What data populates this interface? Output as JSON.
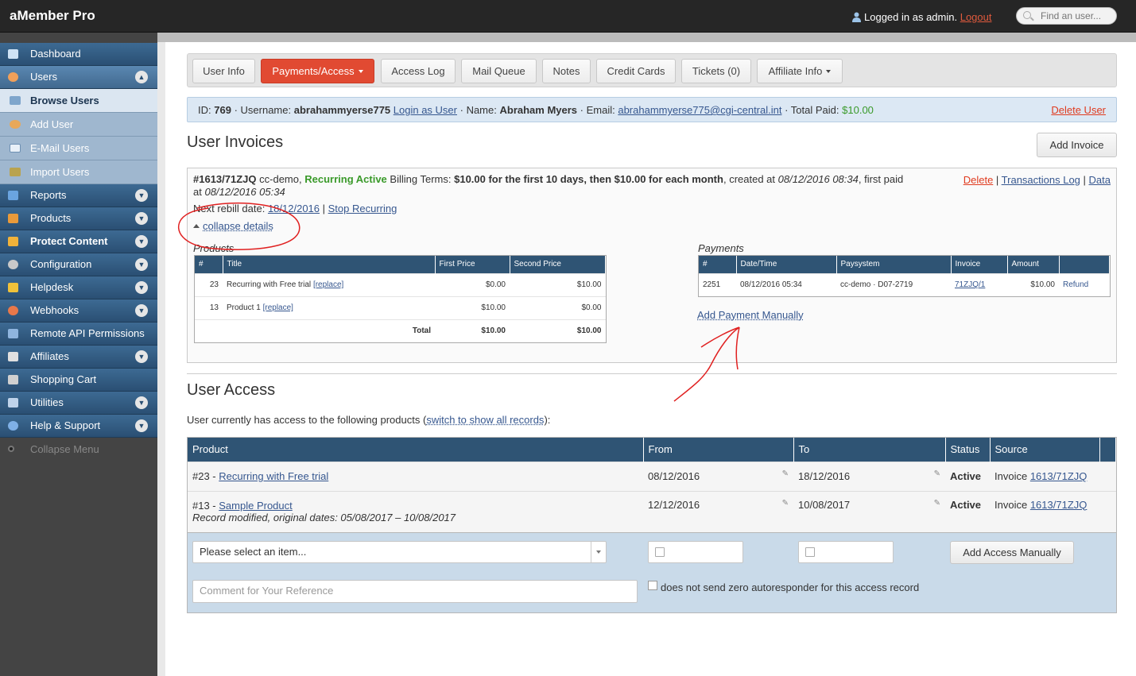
{
  "app": {
    "title": "aMember Pro"
  },
  "header": {
    "logged_in_text": "Logged in as admin.",
    "logout_label": "Logout",
    "search_placeholder": "Find an user..."
  },
  "sidebar": {
    "items": [
      {
        "label": "Dashboard",
        "icon": "dashboard-icon"
      },
      {
        "label": "Users",
        "icon": "users-icon"
      },
      {
        "label": "Browse Users",
        "icon": "browse-users-icon"
      },
      {
        "label": "Add User",
        "icon": "add-user-icon"
      },
      {
        "label": "E-Mail Users",
        "icon": "email-icon"
      },
      {
        "label": "Import Users",
        "icon": "import-icon"
      },
      {
        "label": "Reports",
        "icon": "reports-icon"
      },
      {
        "label": "Products",
        "icon": "products-icon"
      },
      {
        "label": "Protect Content",
        "icon": "lock-icon"
      },
      {
        "label": "Configuration",
        "icon": "gear-icon"
      },
      {
        "label": "Helpdesk",
        "icon": "helpdesk-icon"
      },
      {
        "label": "Webhooks",
        "icon": "webhooks-icon"
      },
      {
        "label": "Remote API Permissions",
        "icon": "api-icon"
      },
      {
        "label": "Affiliates",
        "icon": "affiliates-icon"
      },
      {
        "label": "Shopping Cart",
        "icon": "cart-icon"
      },
      {
        "label": "Utilities",
        "icon": "wrench-icon"
      },
      {
        "label": "Help & Support",
        "icon": "help-icon"
      }
    ],
    "collapse_label": "Collapse Menu"
  },
  "tabs": [
    "User Info",
    "Payments/Access",
    "Access Log",
    "Mail Queue",
    "Notes",
    "Credit Cards",
    "Tickets (0)",
    "Affiliate Info"
  ],
  "info": {
    "id_label": "ID:",
    "id": "769",
    "username_label": "· Username:",
    "username": "abrahammyerse775",
    "login_as": "Login as User",
    "name_label": "· Name:",
    "name": "Abraham Myers",
    "email_label": "· Email:",
    "email": "abrahammyerse775@cgi-central.int",
    "paid_label": "· Total Paid:",
    "paid": "$10.00",
    "delete": "Delete User"
  },
  "invoices": {
    "heading": "User Invoices",
    "add_button": "Add Invoice",
    "invoice_id": "#1613/71ZJQ",
    "paysys": "cc-demo,",
    "status": "Recurring Active",
    "terms_label": "Billing Terms:",
    "terms": "$10.00 for the first 10 days, then $10.00 for each month",
    "created_label": ", created at",
    "created": "08/12/2016 08:34",
    "first_paid_label": ", first paid at",
    "first_paid": "08/12/2016 05:34",
    "rebill_label": "Next rebill date:",
    "rebill_date": "18/12/2016",
    "stop_recurring": "Stop Recurring",
    "links": {
      "delete": "Delete",
      "transactions": "Transactions Log",
      "data": "Data"
    },
    "collapse": "collapse details",
    "products_caption": "Products",
    "products_headers": [
      "#",
      "Title",
      "First Price",
      "Second Price"
    ],
    "products": [
      {
        "num": "23",
        "title": "Recurring with Free trial",
        "replace": "[replace]",
        "first": "$0.00",
        "second": "$10.00"
      },
      {
        "num": "13",
        "title": "Product 1",
        "replace": "[replace]",
        "first": "$10.00",
        "second": "$0.00"
      }
    ],
    "total_label": "Total",
    "total_first": "$10.00",
    "total_second": "$10.00",
    "payments_caption": "Payments",
    "payments_headers": [
      "#",
      "Date/Time",
      "Paysystem",
      "Invoice",
      "Amount",
      ""
    ],
    "payments": [
      {
        "num": "2251",
        "datetime": "08/12/2016 05:34",
        "paysystem": "cc-demo · D07-2719",
        "invoice": "71ZJQ/1",
        "amount": "$10.00",
        "refund": "Refund"
      }
    ],
    "add_payment": "Add Payment Manually"
  },
  "access": {
    "heading": "User Access",
    "note_prefix": "User currently has access to the following products (",
    "note_link": "switch to show all records",
    "note_suffix": "):",
    "headers": [
      "Product",
      "From",
      "To",
      "Status",
      "Source"
    ],
    "rows": [
      {
        "num": "#23 -",
        "product": "Recurring with Free trial",
        "from": "08/12/2016",
        "to": "18/12/2016",
        "status": "Active",
        "source_prefix": "Invoice",
        "source": "1613/71ZJQ",
        "note": ""
      },
      {
        "num": "#13 -",
        "product": "Sample Product",
        "from": "12/12/2016",
        "to": "10/08/2017",
        "status": "Active",
        "source_prefix": "Invoice",
        "source": "1613/71ZJQ",
        "note": "Record modified, original dates: 05/08/2017 – 10/08/2017"
      }
    ],
    "select_placeholder": "Please select an item...",
    "add_button": "Add Access Manually",
    "comment_placeholder": "Comment for Your Reference",
    "checkbox_label": "does not send zero autoresponder for this access record"
  },
  "colors": {
    "accent": "#e14a32",
    "nav": "#2f5474",
    "annotation": "#e02020"
  }
}
